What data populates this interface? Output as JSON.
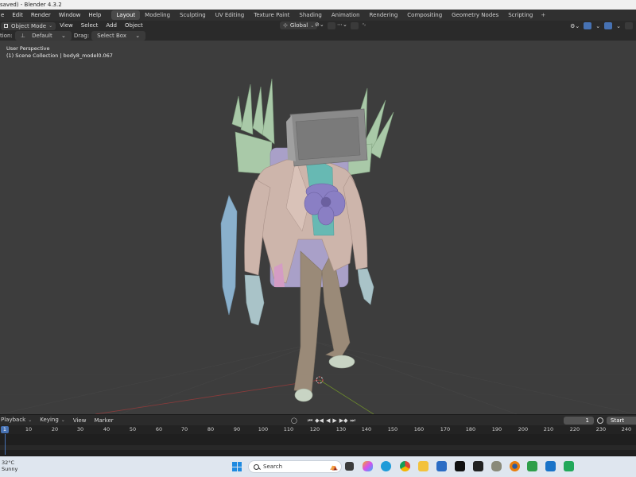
{
  "window": {
    "title": "saved) - Blender 4.3.2"
  },
  "menu": {
    "items": [
      "e",
      "Edit",
      "Render",
      "Window",
      "Help"
    ],
    "workspaces": [
      "Layout",
      "Modeling",
      "Sculpting",
      "UV Editing",
      "Texture Paint",
      "Shading",
      "Animation",
      "Rendering",
      "Compositing",
      "Geometry Nodes",
      "Scripting"
    ],
    "active_workspace": "Layout",
    "add_tab": "+"
  },
  "viewport_header": {
    "mode": "Object Mode",
    "menus": [
      "View",
      "Select",
      "Add",
      "Object"
    ],
    "orientation": "Global"
  },
  "tool_settings": {
    "orientation_label": "tion:",
    "orientation_value": "Default",
    "drag_label": "Drag:",
    "drag_value": "Select Box"
  },
  "viewport": {
    "view_name": "User Perspective",
    "collection_info": "(1) Scene Collection | body8_model0.067"
  },
  "timeline": {
    "menus": [
      "Playback",
      "Keying",
      "View",
      "Marker"
    ],
    "current_frame": "1",
    "start_label": "Start",
    "ruler_ticks": [
      "1",
      "10",
      "20",
      "30",
      "40",
      "50",
      "60",
      "70",
      "80",
      "90",
      "100",
      "110",
      "120",
      "130",
      "140",
      "150",
      "160",
      "170",
      "180",
      "190",
      "200",
      "210",
      "220",
      "230",
      "240"
    ]
  },
  "taskbar": {
    "temperature": "32°C",
    "condition": "Sunny",
    "search_placeholder": "Search"
  },
  "colors": {
    "accent": "#4772b3",
    "viewport_bg": "#3d3d3d",
    "header_bg": "#303030",
    "coat": "#cdb5ab",
    "pants": "#9a8a78",
    "skin": "#a9c3c8",
    "spikes": "#a9c9a8",
    "tv": "#8a8a8a",
    "flower": "#8a7fc4"
  }
}
